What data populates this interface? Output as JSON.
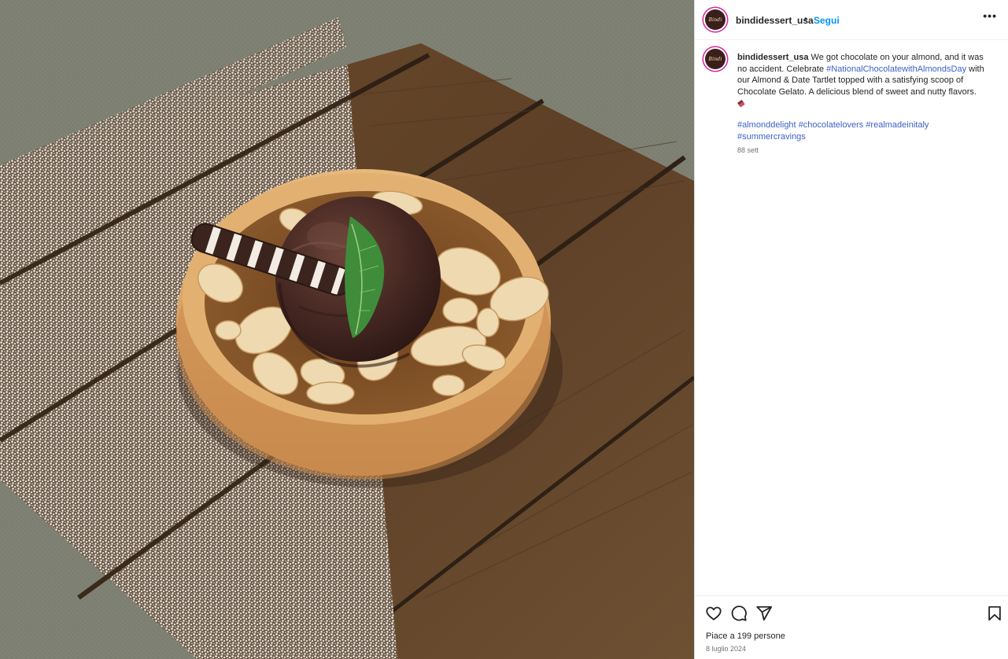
{
  "post": {
    "username": "bindidessert_usa",
    "follow_label": "Segui",
    "separator": "•",
    "more_label": "•••",
    "avatar_logo_text": "Bindi",
    "caption": {
      "username": "bindidessert_usa",
      "text_part1": "We got chocolate on your almond, and it was no accident. Celebrate ",
      "hashtag_inline": "#NationalChocolatewithAlmondsDay",
      "text_part2": " with our Almond & Date Tartlet topped with a satisfying scoop of Chocolate Gelato. A delicious blend of sweet and nutty flavors.",
      "emoji": "chocolate-bar-emoji"
    },
    "hashtags": [
      "#almonddelight",
      "#chocolatelovers",
      "#realmadeinitaly",
      "#summercravings"
    ],
    "time_ago": "88 sett",
    "likes": "Piace a 199 persone",
    "date": "8 luglio 2024"
  },
  "icons": {
    "like": "heart-icon",
    "comment": "comment-icon",
    "share": "share-icon",
    "save": "bookmark-icon"
  },
  "colors": {
    "link": "#3b62c4",
    "follow": "#0095f6",
    "text": "#262626",
    "muted": "#737373",
    "story_ring": "#d6249f"
  }
}
